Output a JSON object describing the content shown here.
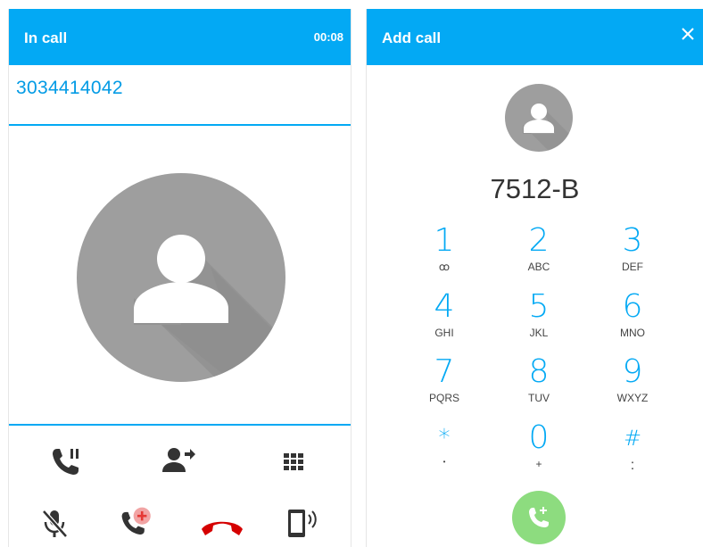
{
  "in_call": {
    "title": "In call",
    "timer": "00:08",
    "number": "3034414042",
    "controls": [
      "hold-icon",
      "transfer-icon",
      "dialpad-icon",
      "mute-icon",
      "add-call-icon",
      "end-call-icon",
      "speaker-icon"
    ]
  },
  "add_call": {
    "title": "Add call",
    "close_icon": "close-icon",
    "dialed_number": "7512-B",
    "keys": [
      {
        "digit": "1",
        "letters": "ꝏ"
      },
      {
        "digit": "2",
        "letters": "ABC"
      },
      {
        "digit": "3",
        "letters": "DEF"
      },
      {
        "digit": "4",
        "letters": "GHI"
      },
      {
        "digit": "5",
        "letters": "JKL"
      },
      {
        "digit": "6",
        "letters": "MNO"
      },
      {
        "digit": "7",
        "letters": "PQRS"
      },
      {
        "digit": "8",
        "letters": "TUV"
      },
      {
        "digit": "9",
        "letters": "WXYZ"
      },
      {
        "digit": "*",
        "letters": "•"
      },
      {
        "digit": "0",
        "letters": "+"
      },
      {
        "digit": "#",
        "letters": ":"
      }
    ],
    "call_button_icon": "add-call-icon"
  },
  "colors": {
    "accent": "#03a9f4",
    "end_call": "#d50000",
    "call_button": "#8ddc7f",
    "avatar_bg": "#9e9e9e"
  }
}
